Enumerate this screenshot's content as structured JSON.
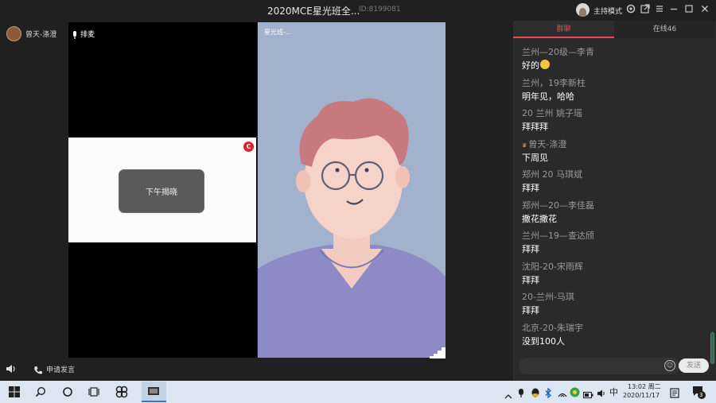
{
  "window": {
    "title": "2020MCE星光班全...",
    "room_id": "ID:8199081",
    "host_mode_label": "主持模式"
  },
  "left_column": {
    "user_name": "曾天-涤澄",
    "request_speak_label": "申请发言"
  },
  "stage": {
    "queue_label": "排麦",
    "block_button_label": "下午揭晓",
    "right_video_label": "星光班-..."
  },
  "chat": {
    "tabs": [
      "群聊",
      "在线46"
    ],
    "messages": [
      {
        "sender": "兰州—20级—李青",
        "text": "好的",
        "emoji": true,
        "crown": false
      },
      {
        "sender": "兰州，19李新柱",
        "text": "明年见，哈哈",
        "emoji": false,
        "crown": false
      },
      {
        "sender": "20  兰州  姚子瑶",
        "text": "拜拜拜",
        "emoji": false,
        "crown": false
      },
      {
        "sender": "曾天-涤澄",
        "text": "下周见",
        "emoji": false,
        "crown": true
      },
      {
        "sender": "郑州 20 马琪斌",
        "text": "拜拜",
        "emoji": false,
        "crown": false
      },
      {
        "sender": "郑州—20—李佳磊",
        "text": "撒花撒花",
        "emoji": false,
        "crown": false
      },
      {
        "sender": "兰州—19—查达颀",
        "text": "拜拜",
        "emoji": false,
        "crown": false
      },
      {
        "sender": "沈阳-20-宋雨辉",
        "text": "拜拜",
        "emoji": false,
        "crown": false
      },
      {
        "sender": "20-兰州-马琪",
        "text": "拜拜",
        "emoji": false,
        "crown": false
      },
      {
        "sender": "北京-20-朱瑞宇",
        "text": "没到100人",
        "emoji": false,
        "crown": false
      }
    ],
    "send_label": "发送"
  },
  "taskbar": {
    "ime": "中",
    "time": "13:02 周二",
    "date": "2020/11/17",
    "notification_count": "3"
  },
  "colors": {
    "accent": "#e74b4b",
    "stage_bg": "#a2b1cc",
    "taskbar_bg": "#dbe6f2"
  }
}
